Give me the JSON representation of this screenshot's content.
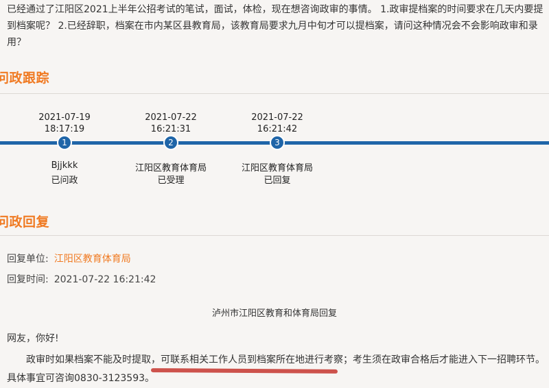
{
  "question": {
    "text": "已经通过了江阳区2021上半年公招考试的笔试，面试，体检，现在想咨询政审的事情。 1.政审提档案的时间要求在几天内要提到档案呢？ 2.已经辞职，档案在市内某区县教育局，该教育局要求九月中旬才可以提档案，请问这种情况会不会影响政审和录用？"
  },
  "tracking": {
    "title": "问政跟踪",
    "steps": [
      {
        "number": "1",
        "date": "2021-07-19",
        "time": "18:17:19",
        "who": "Bjjkkk",
        "status": "已问政"
      },
      {
        "number": "2",
        "date": "2021-07-22",
        "time": "16:21:31",
        "who": "江阳区教育体育局",
        "status": "已受理"
      },
      {
        "number": "3",
        "date": "2021-07-22",
        "time": "16:21:42",
        "who": "江阳区教育体育局",
        "status": "已回复"
      }
    ]
  },
  "reply": {
    "title": "问政回复",
    "unit_label": "回复单位:",
    "unit_value": "江阳区教育体育局",
    "time_label": "回复时间:",
    "time_value": "2021-07-22 16:21:42",
    "heading": "泸州市江阳区教育和体育局回复",
    "greeting": "网友，你好!",
    "body": "政审时如果档案不能及时提取，可联系相关工作人员到档案所在地进行考察；考生须在政审合格后才能进入下一招聘环节。具体事宜可咨询0830-3123593。"
  },
  "colors": {
    "accent": "#f07a22",
    "timeline": "#1f65a8",
    "underline": "#c8403a"
  }
}
